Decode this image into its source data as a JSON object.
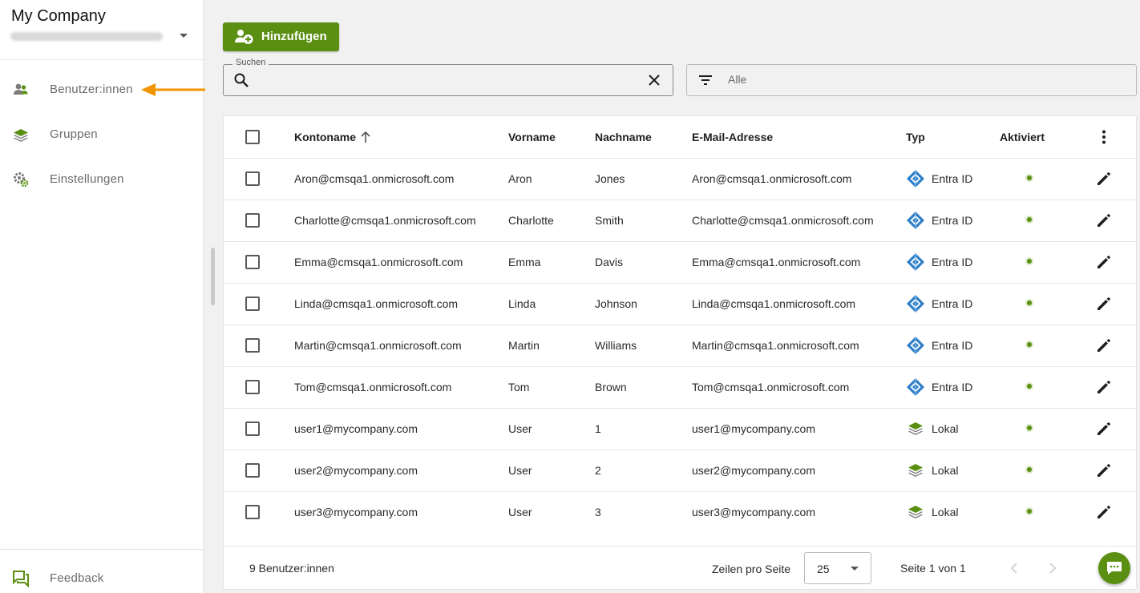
{
  "sidebar": {
    "company": "My Company",
    "nav": [
      {
        "label": "Benutzer:innen",
        "icon": "users-icon"
      },
      {
        "label": "Gruppen",
        "icon": "layers-icon"
      },
      {
        "label": "Einstellungen",
        "icon": "settings-gear-icon"
      }
    ],
    "feedback": "Feedback"
  },
  "toolbar": {
    "add_label": "Hinzufügen",
    "search_legend": "Suchen",
    "search_value": "",
    "filter_value": "Alle"
  },
  "table": {
    "headers": {
      "account": "Kontoname",
      "first": "Vorname",
      "last": "Nachname",
      "email": "E-Mail-Adresse",
      "type": "Typ",
      "active": "Aktiviert"
    },
    "rows": [
      {
        "account": "Aron@cmsqa1.onmicrosoft.com",
        "first": "Aron",
        "last": "Jones",
        "email": "Aron@cmsqa1.onmicrosoft.com",
        "type": "Entra ID"
      },
      {
        "account": "Charlotte@cmsqa1.onmicrosoft.com",
        "first": "Charlotte",
        "last": "Smith",
        "email": "Charlotte@cmsqa1.onmicrosoft.com",
        "type": "Entra ID"
      },
      {
        "account": "Emma@cmsqa1.onmicrosoft.com",
        "first": "Emma",
        "last": "Davis",
        "email": "Emma@cmsqa1.onmicrosoft.com",
        "type": "Entra ID"
      },
      {
        "account": "Linda@cmsqa1.onmicrosoft.com",
        "first": "Linda",
        "last": "Johnson",
        "email": "Linda@cmsqa1.onmicrosoft.com",
        "type": "Entra ID"
      },
      {
        "account": "Martin@cmsqa1.onmicrosoft.com",
        "first": "Martin",
        "last": "Williams",
        "email": "Martin@cmsqa1.onmicrosoft.com",
        "type": "Entra ID"
      },
      {
        "account": "Tom@cmsqa1.onmicrosoft.com",
        "first": "Tom",
        "last": "Brown",
        "email": "Tom@cmsqa1.onmicrosoft.com",
        "type": "Entra ID"
      },
      {
        "account": "user1@mycompany.com",
        "first": "User",
        "last": "1",
        "email": "user1@mycompany.com",
        "type": "Lokal"
      },
      {
        "account": "user2@mycompany.com",
        "first": "User",
        "last": "2",
        "email": "user2@mycompany.com",
        "type": "Lokal"
      },
      {
        "account": "user3@mycompany.com",
        "first": "User",
        "last": "3",
        "email": "user3@mycompany.com",
        "type": "Lokal"
      }
    ]
  },
  "footer": {
    "count": "9 Benutzer:innen",
    "rows_per_page_label": "Zeilen pro Seite",
    "rows_per_page": "25",
    "page_info": "Seite 1 von 1"
  },
  "colors": {
    "accent": "#5a8f12",
    "entra_blue": "#2f7fc6",
    "arrow_orange": "#f29400"
  }
}
